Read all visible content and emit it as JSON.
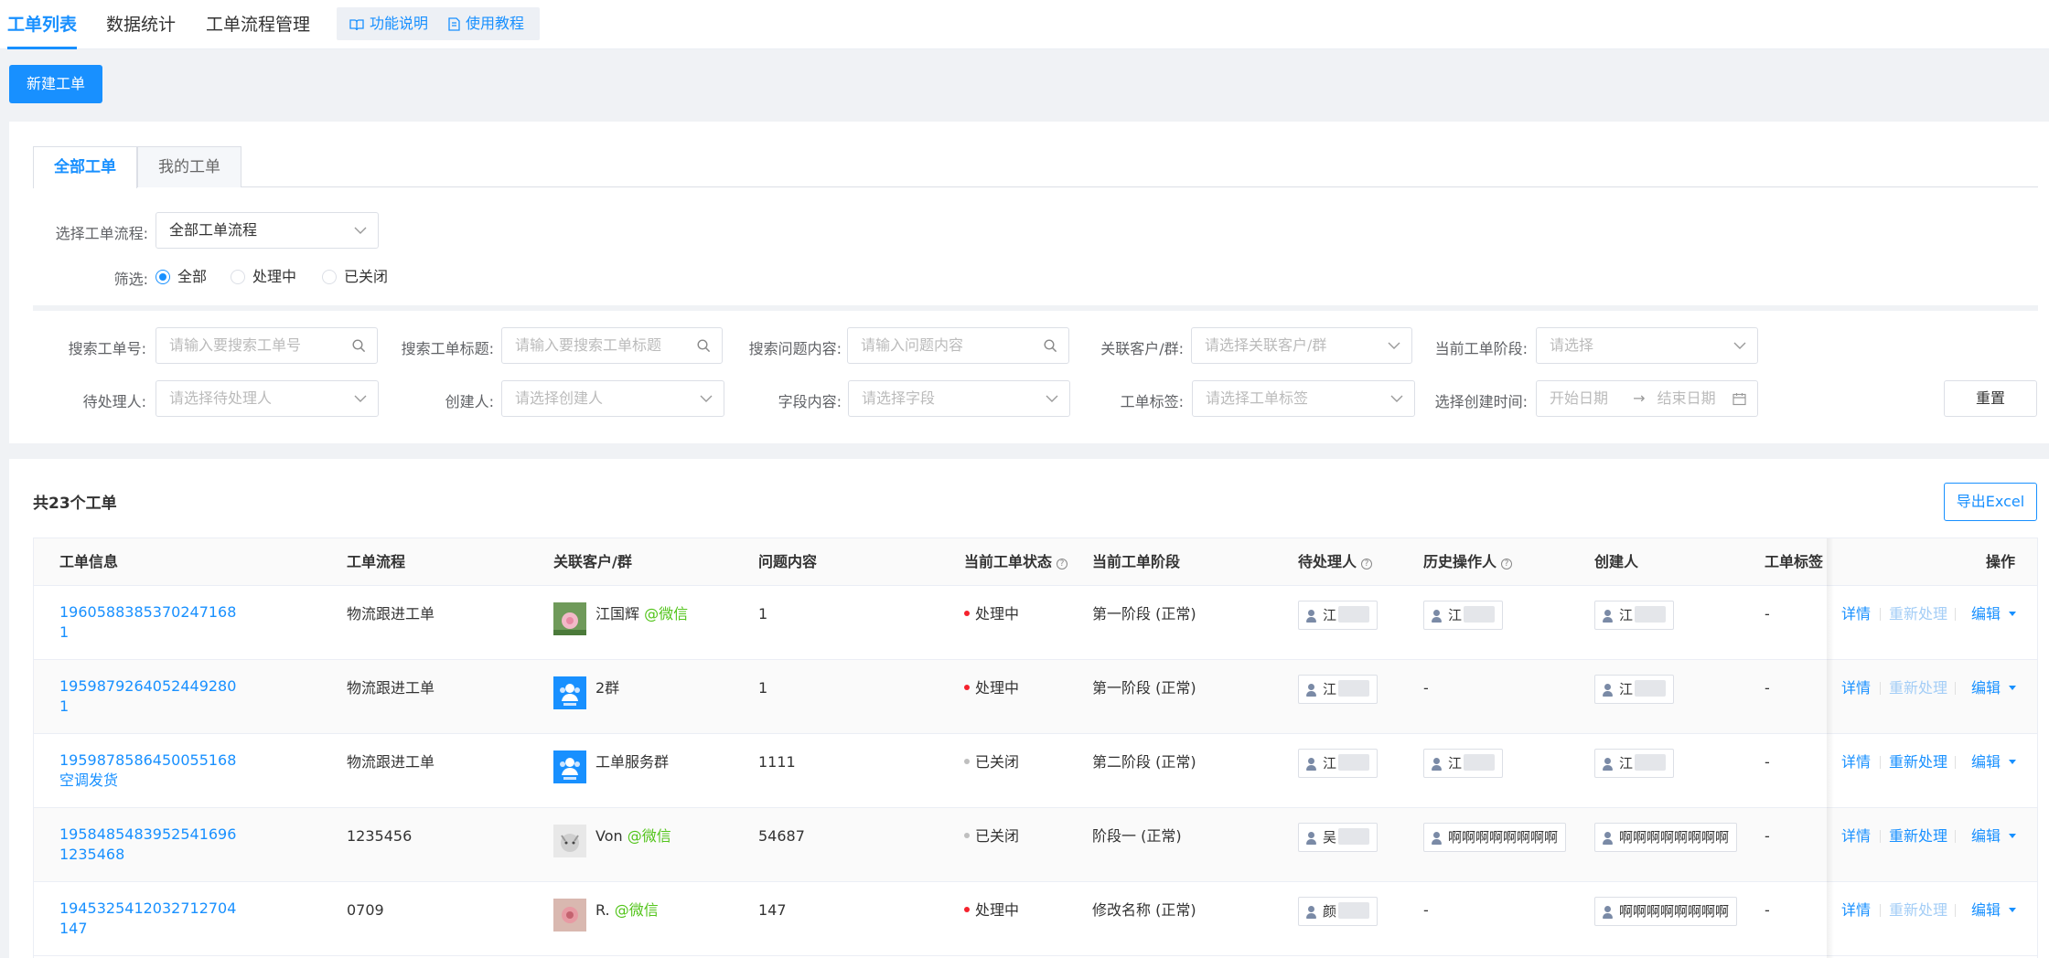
{
  "nav": {
    "tabs": [
      "工单列表",
      "数据统计",
      "工单流程管理"
    ],
    "help": {
      "feature_doc": "功能说明",
      "tutorial": "使用教程"
    }
  },
  "toolbar": {
    "new_ticket": "新建工单"
  },
  "filter_tabs": [
    "全部工单",
    "我的工单"
  ],
  "filters": {
    "flow_label": "选择工单流程:",
    "flow_value": "全部工单流程",
    "status_label": "筛选:",
    "status_options": [
      "全部",
      "处理中",
      "已关闭"
    ],
    "status_selected": "全部",
    "search_no_label": "搜索工单号:",
    "search_no_placeholder": "请输入要搜索工单号",
    "search_title_label": "搜索工单标题:",
    "search_title_placeholder": "请输入要搜索工单标题",
    "search_content_label": "搜索问题内容:",
    "search_content_placeholder": "请输入问题内容",
    "customer_label": "关联客户/群:",
    "customer_placeholder": "请选择关联客户/群",
    "stage_label": "当前工单阶段:",
    "stage_placeholder": "请选择",
    "assignee_label": "待处理人:",
    "assignee_placeholder": "请选择待处理人",
    "creator_label": "创建人:",
    "creator_placeholder": "请选择创建人",
    "field_label": "字段内容:",
    "field_placeholder": "请选择字段",
    "tag_label": "工单标签:",
    "tag_placeholder": "请选择工单标签",
    "date_label": "选择创建时间:",
    "date_start_placeholder": "开始日期",
    "date_arrow": "→",
    "date_end_placeholder": "结束日期",
    "reset": "重置"
  },
  "list": {
    "total": "共23个工单",
    "export": "导出Excel",
    "headers": [
      "工单信息",
      "工单流程",
      "关联客户/群",
      "问题内容",
      "当前工单状态",
      "当前工单阶段",
      "待处理人",
      "历史操作人",
      "创建人",
      "工单标签",
      "操作"
    ],
    "actions": {
      "detail": "详情",
      "reprocess": "重新处理",
      "edit": "编辑"
    },
    "rows": [
      {
        "no": "1960588385370247168",
        "no2": "1",
        "flow": "物流跟进工单",
        "customer": "江国辉",
        "wechat": "@微信",
        "avatar": "photo-lotus",
        "content": "1",
        "status": "处理中",
        "status_color": "#f5222d",
        "stage": "第一阶段 (正常)",
        "assignee": "江",
        "history": "江",
        "creator": "江",
        "tag": "-",
        "reprocess_enabled": false
      },
      {
        "no": "1959879264052449280",
        "no2": "1",
        "flow": "物流跟进工单",
        "customer": "2群",
        "wechat": "",
        "avatar": "group",
        "content": "1",
        "status": "处理中",
        "status_color": "#f5222d",
        "stage": "第一阶段 (正常)",
        "assignee": "江",
        "history": "-",
        "creator": "江",
        "tag": "-",
        "reprocess_enabled": false
      },
      {
        "no": "1959878586450055168",
        "no2": "空调发货",
        "flow": "物流跟进工单",
        "customer": "工单服务群",
        "wechat": "",
        "avatar": "group",
        "content": "1111",
        "status": "已关闭",
        "status_color": "#bfbfbf",
        "stage": "第二阶段 (正常)",
        "assignee": "江",
        "history": "江",
        "creator": "江",
        "tag": "-",
        "reprocess_enabled": true
      },
      {
        "no": "1958485483952541696",
        "no2": "1235468",
        "flow": "1235456",
        "customer": "Von",
        "wechat": "@微信",
        "avatar": "photo-cat",
        "content": "54687",
        "status": "已关闭",
        "status_color": "#bfbfbf",
        "stage": "阶段一 (正常)",
        "assignee": "吴",
        "history": "啊啊啊啊啊啊啊啊",
        "creator": "啊啊啊啊啊啊啊啊",
        "tag": "-",
        "reprocess_enabled": true
      },
      {
        "no": "1945325412032712704",
        "no2": "147",
        "flow": "0709",
        "customer": "R.",
        "wechat": "@微信",
        "avatar": "photo-flower",
        "content": "147",
        "status": "处理中",
        "status_color": "#f5222d",
        "stage": "修改名称 (正常)",
        "assignee": "颜",
        "history": "-",
        "creator": "啊啊啊啊啊啊啊啊",
        "tag": "-",
        "reprocess_enabled": false
      }
    ]
  },
  "colors": {
    "primary": "#1890ff",
    "bg": "#f0f2f5"
  }
}
